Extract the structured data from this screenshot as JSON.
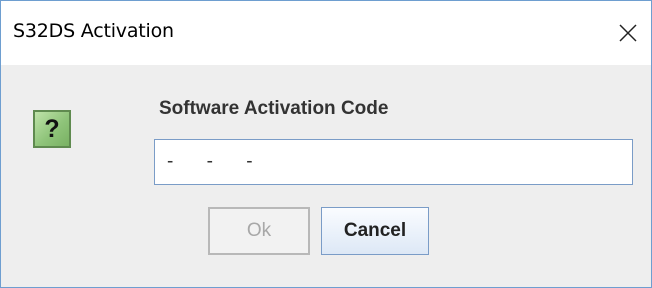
{
  "window": {
    "title": "S32DS Activation",
    "close_icon": "close-icon"
  },
  "dialog": {
    "icon": "question-icon",
    "icon_glyph": "?",
    "label": "Software Activation Code",
    "code_value": "- - -",
    "buttons": {
      "ok_label": "Ok",
      "ok_enabled": false,
      "cancel_label": "Cancel"
    }
  },
  "colors": {
    "window_border": "#6e9ed0",
    "content_bg": "#eeeeee",
    "icon_green": "#8fc47a",
    "input_border": "#7a9cc7"
  }
}
